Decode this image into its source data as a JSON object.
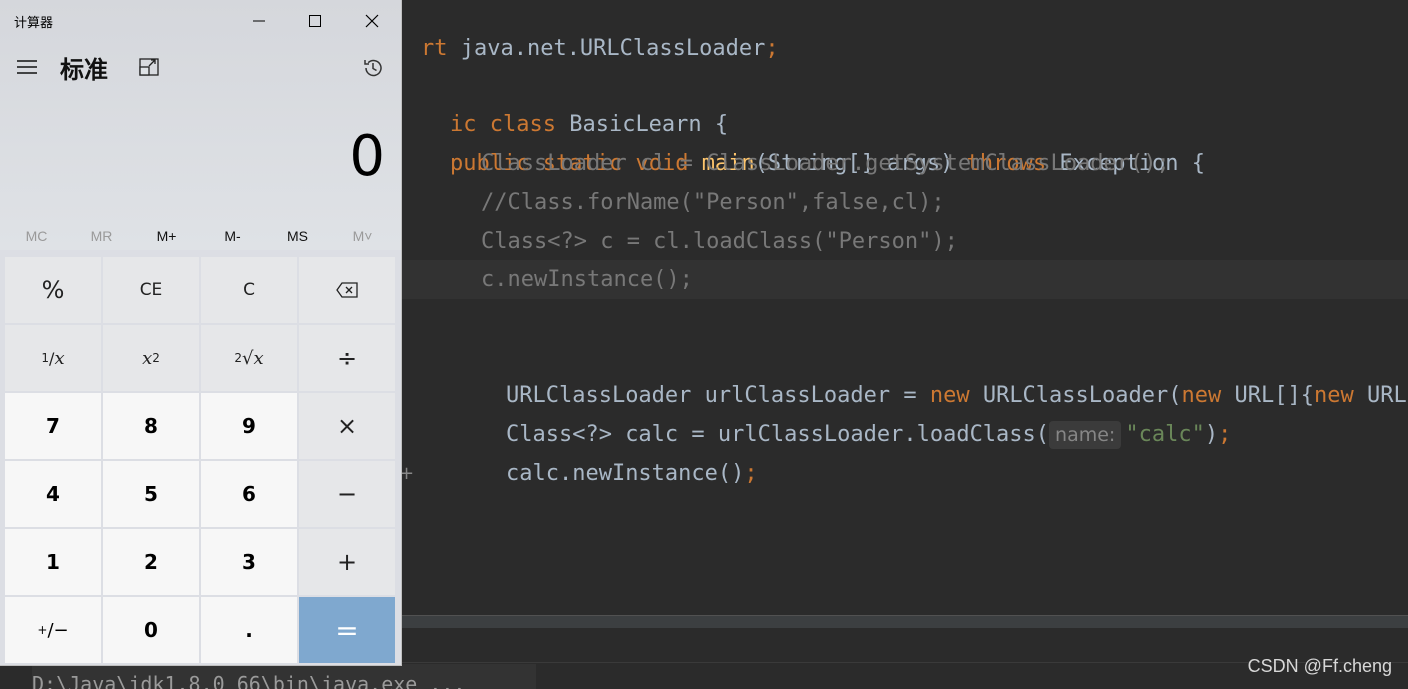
{
  "editor": {
    "line1": {
      "kw": "rt",
      "rest": " java.net.URLClassLoader",
      "semi": ";"
    },
    "line2": {
      "kw1": "ic",
      "kw2": "class",
      "name": " BasicLearn {"
    },
    "line3": {
      "kw1": "public",
      "kw2": "static",
      "kw3": "void",
      "fn": "main",
      "params": "(String[] args) ",
      "kw4": "throws",
      "rest": " Exception {"
    },
    "line4": "ClassLoader cl = ClassLoader.getSystemClassLoader();",
    "line5": "//Class.forName(\"Person\",false,cl);",
    "line6": "Class<?> c = cl.loadClass(\"Person\");",
    "line7": "c.newInstance();",
    "line8": {
      "a": "URLClassLoader urlClassLoader = ",
      "kw1": "new",
      "b": " URLClassLoader(",
      "kw2": "new",
      "c": " URL[]{",
      "kw3": "new",
      "d": " URL"
    },
    "line9": {
      "a": "Class<?> calc = urlClassLoader.loadClass(",
      "hint": "name:",
      "str": "\"calc\"",
      "b": ")",
      "semi": ";"
    },
    "line10": {
      "a": "calc.newInstance()",
      "semi": ";"
    },
    "fold_marker": "+"
  },
  "run_panel": {
    "output_line": "D:\\Java\\jdk1.8.0_66\\bin\\java.exe ..."
  },
  "watermark": "CSDN @Ff.cheng",
  "calculator": {
    "window_title": "计算器",
    "mode": "标准",
    "display_value": "0",
    "memory": [
      "MC",
      "MR",
      "M+",
      "M-",
      "MS",
      "M˅"
    ],
    "keys": {
      "percent": "%",
      "ce": "CE",
      "c": "C",
      "reciprocal_num": "1",
      "reciprocal_den": "x",
      "square_base": "x",
      "square_exp": "2",
      "sqrt_index": "2",
      "sqrt_sym": "√",
      "sqrt_var": "x",
      "divide": "÷",
      "seven": "7",
      "eight": "8",
      "nine": "9",
      "multiply": "×",
      "four": "4",
      "five": "5",
      "six": "6",
      "minus": "−",
      "one": "1",
      "two": "2",
      "three": "3",
      "plus": "+",
      "negate_plus": "+",
      "negate_minus": "/−",
      "zero": "0",
      "decimal": ".",
      "equals": "="
    }
  },
  "colors": {
    "editor_bg": "#2b2b2b",
    "keyword": "#cc7832",
    "function": "#ffc66d",
    "string": "#6a8759",
    "comment": "#808080",
    "equals_key": "#7fa8cf"
  }
}
